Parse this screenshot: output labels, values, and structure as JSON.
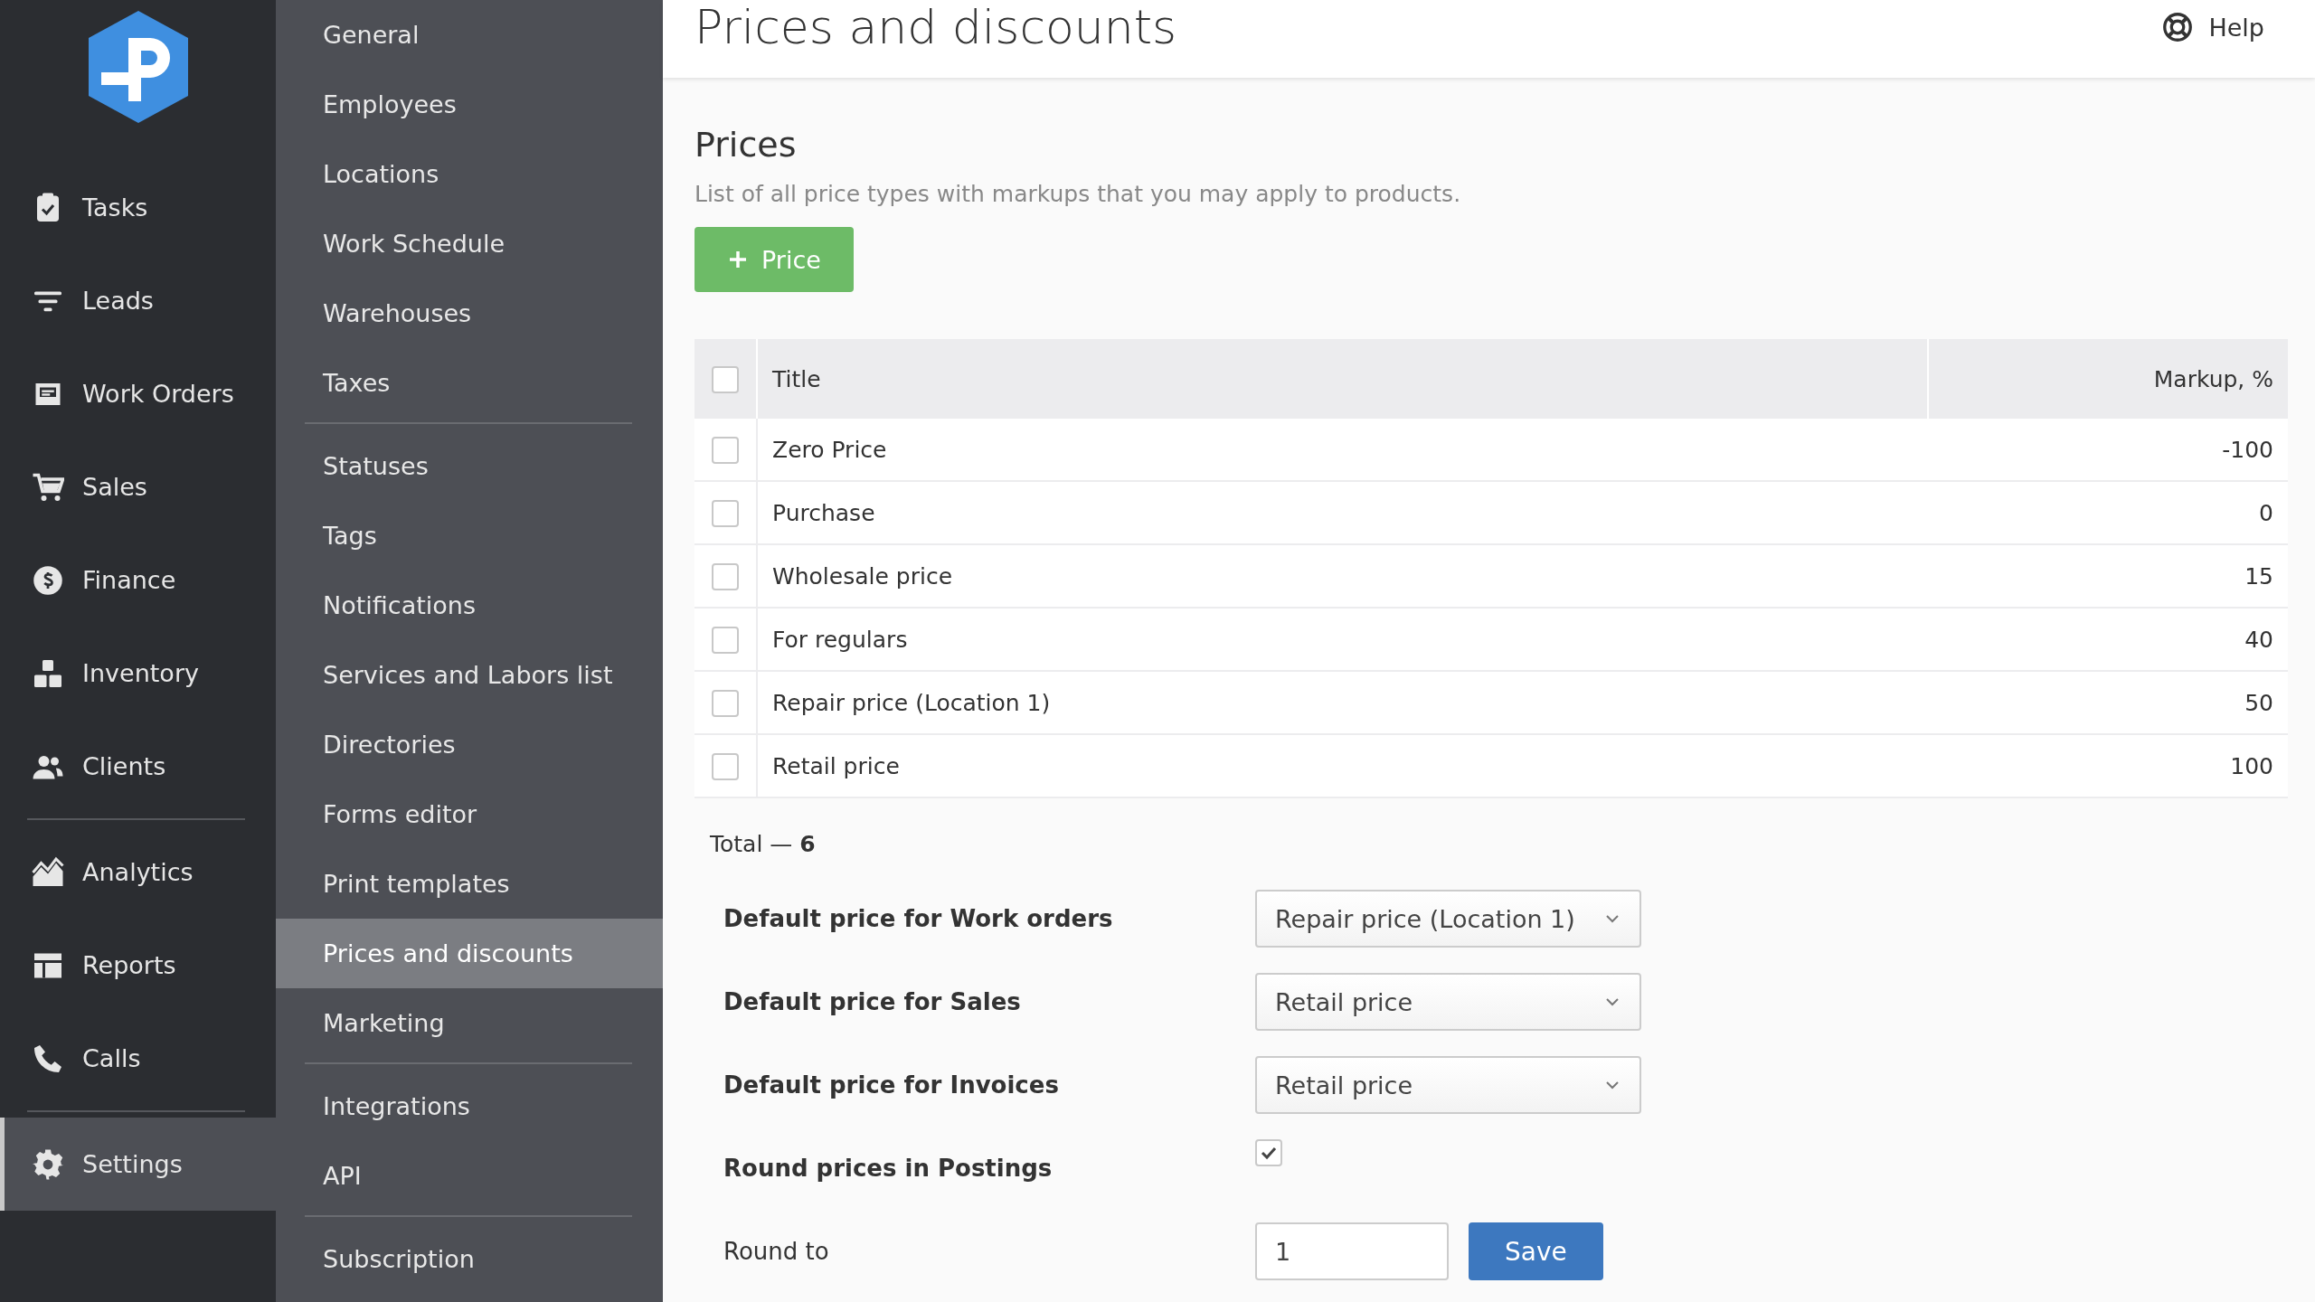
{
  "nav": {
    "groups": [
      {
        "items": [
          {
            "label": "Tasks",
            "selected": false
          },
          {
            "label": "Leads",
            "selected": false
          },
          {
            "label": "Work Orders",
            "selected": false
          },
          {
            "label": "Sales",
            "selected": false
          },
          {
            "label": "Finance",
            "selected": false
          },
          {
            "label": "Inventory",
            "selected": false
          },
          {
            "label": "Clients",
            "selected": false
          }
        ]
      },
      {
        "items": [
          {
            "label": "Analytics",
            "selected": false
          },
          {
            "label": "Reports",
            "selected": false
          },
          {
            "label": "Calls",
            "selected": false
          }
        ]
      },
      {
        "items": [
          {
            "label": "Settings",
            "selected": true
          }
        ]
      }
    ]
  },
  "submenu": {
    "groups": [
      {
        "items": [
          {
            "label": "General",
            "selected": false
          },
          {
            "label": "Employees",
            "selected": false
          },
          {
            "label": "Locations",
            "selected": false
          },
          {
            "label": "Work Schedule",
            "selected": false
          },
          {
            "label": "Warehouses",
            "selected": false
          },
          {
            "label": "Taxes",
            "selected": false
          }
        ]
      },
      {
        "items": [
          {
            "label": "Statuses",
            "selected": false
          },
          {
            "label": "Tags",
            "selected": false
          },
          {
            "label": "Notifications",
            "selected": false
          },
          {
            "label": "Services and Labors list",
            "selected": false
          },
          {
            "label": "Directories",
            "selected": false
          },
          {
            "label": "Forms editor",
            "selected": false
          },
          {
            "label": "Print templates",
            "selected": false
          },
          {
            "label": "Prices and discounts",
            "selected": true
          },
          {
            "label": "Marketing",
            "selected": false
          }
        ]
      },
      {
        "items": [
          {
            "label": "Integrations",
            "selected": false
          },
          {
            "label": "API",
            "selected": false
          }
        ]
      },
      {
        "items": [
          {
            "label": "Subscription",
            "selected": false
          }
        ]
      }
    ]
  },
  "header": {
    "title": "Prices and discounts",
    "help": "Help"
  },
  "prices": {
    "heading": "Prices",
    "description": "List of all price types with markups that you may apply to products.",
    "add_button": "Price",
    "table": {
      "header_checked": false,
      "columns": [
        "Title",
        "Markup, %"
      ],
      "rows": [
        {
          "title": "Zero Price",
          "markup": "-100",
          "checked": false
        },
        {
          "title": "Purchase",
          "markup": "0",
          "checked": false
        },
        {
          "title": "Wholesale price",
          "markup": "15",
          "checked": false
        },
        {
          "title": "For regulars",
          "markup": "40",
          "checked": false
        },
        {
          "title": "Repair price (Location 1)",
          "markup": "50",
          "checked": false
        },
        {
          "title": "Retail price",
          "markup": "100",
          "checked": false
        }
      ]
    },
    "total": "Total — **6**"
  },
  "settings": [
    {
      "kind": "select",
      "label": "Default price for Work orders",
      "value": "Repair price (Location 1)"
    },
    {
      "kind": "select",
      "label": "Default price for Sales",
      "value": "Retail price"
    },
    {
      "kind": "select",
      "label": "Default price for Invoices",
      "value": "Retail price"
    },
    {
      "kind": "checkbox",
      "label": "Round prices in Postings",
      "checked": true
    },
    {
      "kind": "input",
      "label": "Round to",
      "value": "1",
      "button": "Save"
    }
  ]
}
